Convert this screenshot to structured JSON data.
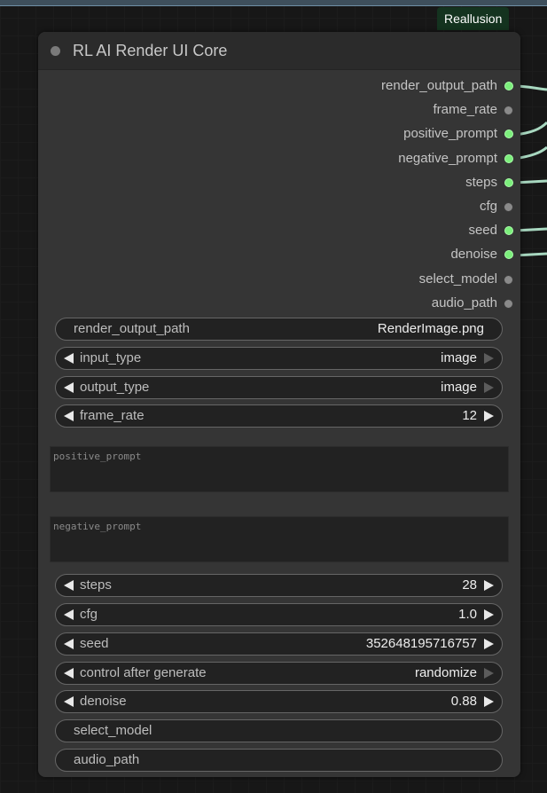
{
  "brand_badge": "Reallusion",
  "node": {
    "title": "RL AI Render UI Core",
    "outputs": [
      {
        "label": "render_output_path",
        "connected": true
      },
      {
        "label": "frame_rate",
        "connected": false
      },
      {
        "label": "positive_prompt",
        "connected": true
      },
      {
        "label": "negative_prompt",
        "connected": true
      },
      {
        "label": "steps",
        "connected": true
      },
      {
        "label": "cfg",
        "connected": false
      },
      {
        "label": "seed",
        "connected": true
      },
      {
        "label": "denoise",
        "connected": true
      },
      {
        "label": "select_model",
        "connected": false
      },
      {
        "label": "audio_path",
        "connected": false
      }
    ],
    "widgets": {
      "render_output_path": {
        "name": "render_output_path",
        "value": "RenderImage.png"
      },
      "input_type": {
        "name": "input_type",
        "value": "image"
      },
      "output_type": {
        "name": "output_type",
        "value": "image"
      },
      "frame_rate": {
        "name": "frame_rate",
        "value": "12"
      },
      "positive_prompt": {
        "placeholder": "positive_prompt",
        "value": ""
      },
      "negative_prompt": {
        "placeholder": "negative_prompt",
        "value": ""
      },
      "steps": {
        "name": "steps",
        "value": "28"
      },
      "cfg": {
        "name": "cfg",
        "value": "1.0"
      },
      "seed": {
        "name": "seed",
        "value": "352648195716757"
      },
      "control_after_generate": {
        "name": "control after generate",
        "value": "randomize"
      },
      "denoise": {
        "name": "denoise",
        "value": "0.88"
      },
      "select_model": {
        "name": "select_model",
        "value": ""
      },
      "audio_path": {
        "name": "audio_path",
        "value": ""
      }
    }
  },
  "colors": {
    "connected_slot": "#7cef7c",
    "unconnected_slot": "#8a8a8a",
    "node_body": "#353535",
    "node_title": "#2b2b2b",
    "badge_bg": "#14331f",
    "wire": "#a8d8c0"
  },
  "icons": {
    "title_dot": "status-dot-icon",
    "decrement": "triangle-left-icon",
    "increment": "triangle-right-icon"
  }
}
